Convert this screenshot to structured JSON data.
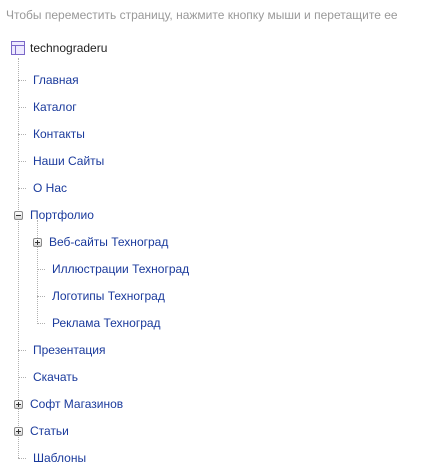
{
  "instruction": "Чтобы переместить страницу, нажмите кнопку мыши и перетащите ее",
  "tree": {
    "root": {
      "label": "technograderu",
      "icon": "sitemap-icon"
    },
    "items": [
      {
        "label": "Главная"
      },
      {
        "label": "Каталог"
      },
      {
        "label": "Контакты"
      },
      {
        "label": "Наши Сайты"
      },
      {
        "label": "О Нас"
      },
      {
        "label": "Портфолио",
        "state": "expanded",
        "children": [
          {
            "label": "Веб-сайты Техноград",
            "state": "collapsed"
          },
          {
            "label": "Иллюстрации Техноград"
          },
          {
            "label": "Логотипы Техноград"
          },
          {
            "label": "Реклама Техноград"
          }
        ]
      },
      {
        "label": "Презентация"
      },
      {
        "label": "Скачать"
      },
      {
        "label": "Софт Магазинов",
        "state": "collapsed"
      },
      {
        "label": "Статьи",
        "state": "collapsed"
      },
      {
        "label": "Шаблоны"
      }
    ]
  },
  "colors": {
    "link": "#1a3a9c",
    "instruction": "#999999",
    "root_icon": "#7b68c8"
  }
}
